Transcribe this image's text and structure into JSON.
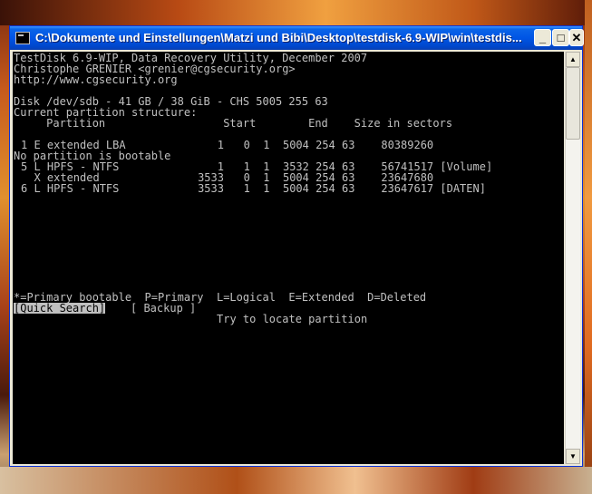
{
  "window": {
    "title": "C:\\Dokumente und Einstellungen\\Matzi und Bibi\\Desktop\\testdisk-6.9-WIP\\win\\testdis...",
    "controls": {
      "minimize": "_",
      "maximize": "□",
      "close": "✕"
    }
  },
  "console": {
    "header": [
      "TestDisk 6.9-WIP, Data Recovery Utility, December 2007",
      "Christophe GRENIER <grenier@cgsecurity.org>",
      "http://www.cgsecurity.org"
    ],
    "disk_line": "Disk /dev/sdb - 41 GB / 38 GiB - CHS 5005 255 63",
    "structure_label": "Current partition structure:",
    "columns_line": "     Partition                  Start        End    Size in sectors",
    "partitions": [
      "1 E extended LBA              1   0  1  5004 254 63    80389260",
      "No partition is bootable",
      "5 L HPFS - NTFS               1   1  1  3532 254 63    56741517 [Volume]",
      "  X extended               3533   0  1  5004 254 63    23647680",
      "6 L HPFS - NTFS            3533   1  1  5004 254 63    23647617 [DATEN]"
    ],
    "legend": "*=Primary bootable  P=Primary  L=Logical  E=Extended  D=Deleted",
    "menu": {
      "quick_search": "[Quick Search]",
      "backup": "[ Backup ]"
    },
    "hint": "Try to locate partition"
  },
  "scrollbar": {
    "up_icon": "▲",
    "down_icon": "▼"
  }
}
